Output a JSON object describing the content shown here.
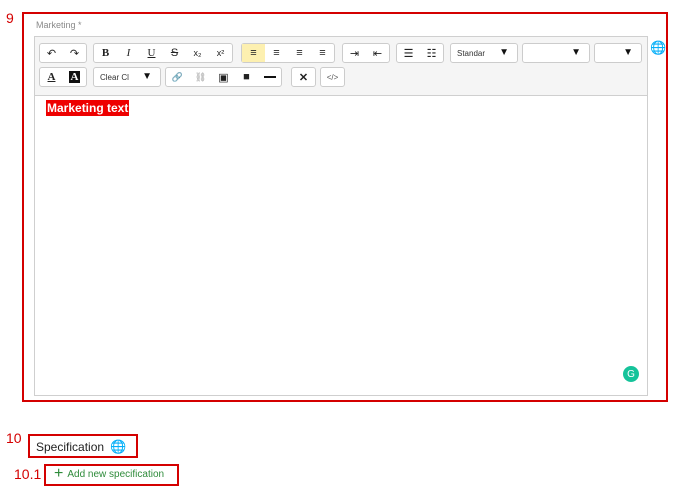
{
  "annotations": {
    "editor_number": "9",
    "spec_number": "10",
    "add_number": "10.1"
  },
  "marketing": {
    "label": "Marketing *",
    "content_text": "Marketing text",
    "toolbar": {
      "history": [
        {
          "name": "undo-button",
          "glyph": "↶"
        },
        {
          "name": "redo-button",
          "glyph": "↷"
        }
      ],
      "format": [
        {
          "name": "bold-button",
          "glyph": "B"
        },
        {
          "name": "italic-button",
          "glyph": "I"
        },
        {
          "name": "underline-button",
          "glyph": "U"
        },
        {
          "name": "strikethrough-button",
          "glyph": "S"
        },
        {
          "name": "subscript-button",
          "glyph": "x₂"
        },
        {
          "name": "superscript-button",
          "glyph": "x²"
        }
      ],
      "align": [
        {
          "name": "align-left-button",
          "glyph": "≡",
          "active": true
        },
        {
          "name": "align-center-button",
          "glyph": "≡"
        },
        {
          "name": "align-right-button",
          "glyph": "≡"
        },
        {
          "name": "align-justify-button",
          "glyph": "≡"
        }
      ],
      "indent": [
        {
          "name": "indent-button",
          "glyph": "⇥"
        },
        {
          "name": "outdent-button",
          "glyph": "⇤"
        }
      ],
      "lists": [
        {
          "name": "bullet-list-button",
          "glyph": "☰"
        },
        {
          "name": "numbered-list-button",
          "glyph": "☷"
        }
      ],
      "paragraph_style": "Standar",
      "font_family": "",
      "font_size": "",
      "clear_label": "Clear Cl",
      "caret": "▼",
      "font_color_glyph": "A",
      "bg_color_glyph": "A",
      "link_glyph": "🔗",
      "unlink_glyph": "⛓",
      "image_glyph": "▣",
      "video_glyph": "■",
      "remove_format_glyph": "✕",
      "code_glyph": "</>"
    },
    "grammarly_glyph": "G"
  },
  "specification": {
    "label": "Specification",
    "add_label": "Add new specification",
    "plus_glyph": "+"
  },
  "globe_glyph": "🌐",
  "colors": {
    "annotation_red": "#d40000",
    "highlight_red": "#ee0000",
    "link_green": "#2e8b3a",
    "active_yellow": "#fdf0b0"
  }
}
